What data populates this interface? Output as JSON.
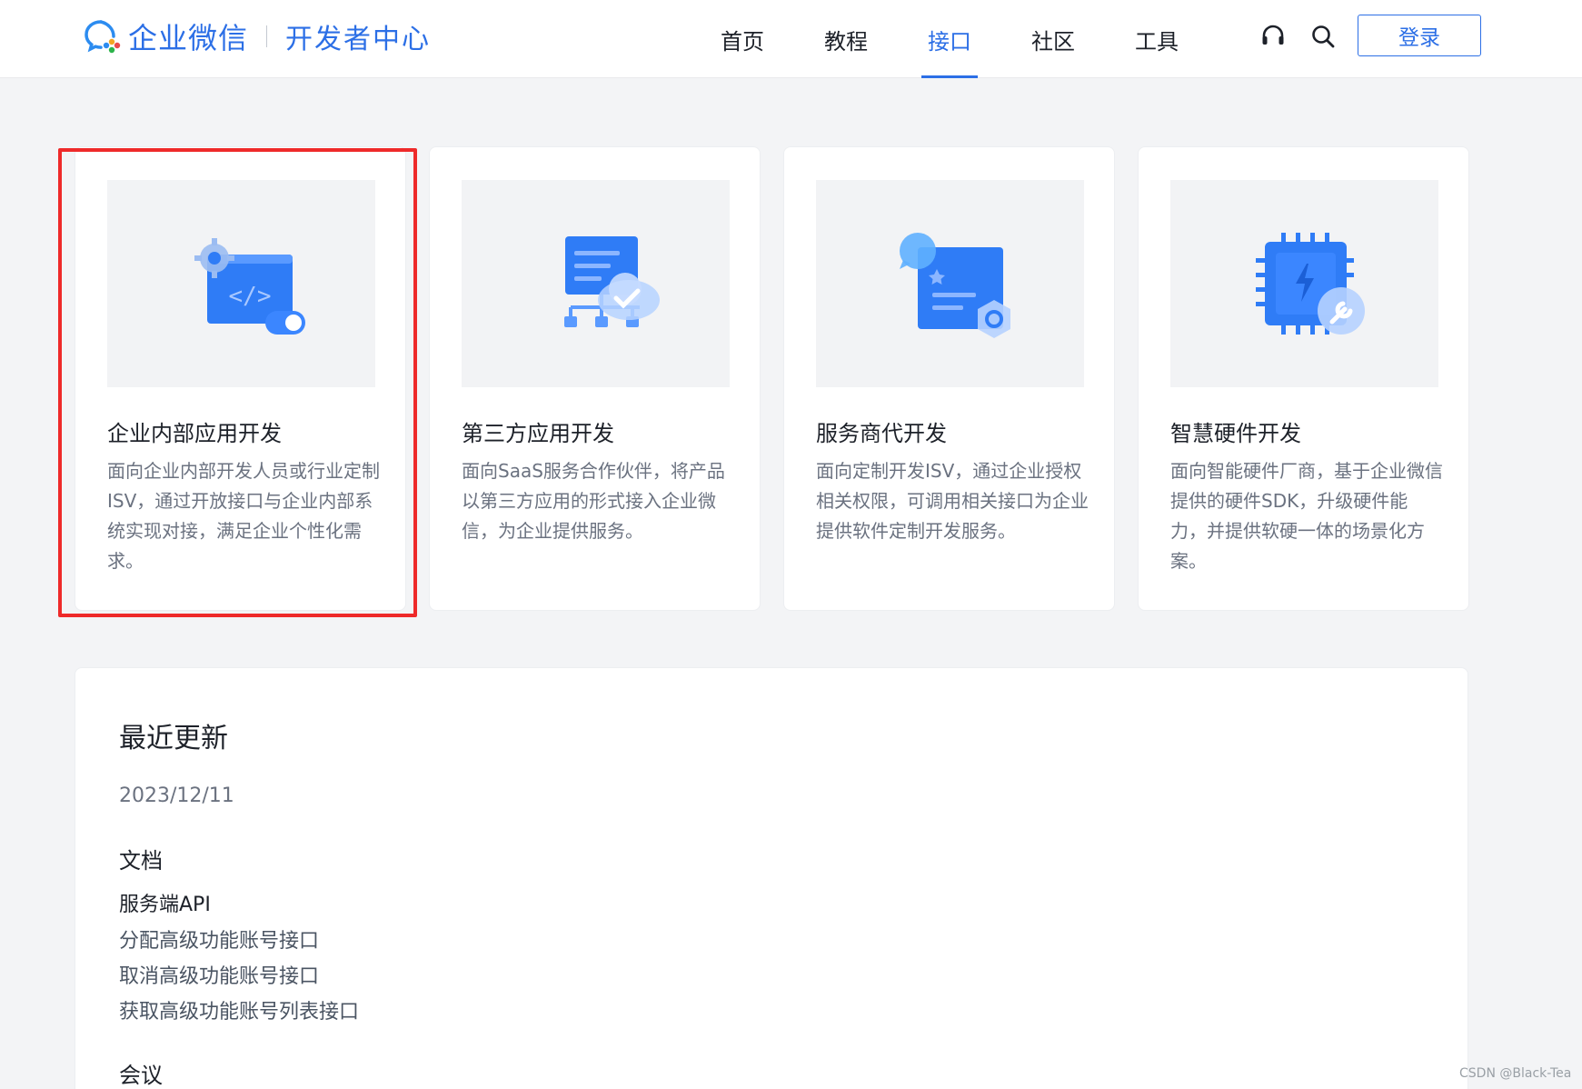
{
  "header": {
    "brand": "企业微信",
    "subtitle": "开发者中心",
    "nav": [
      {
        "label": "首页"
      },
      {
        "label": "教程"
      },
      {
        "label": "接口",
        "active": true
      },
      {
        "label": "社区"
      },
      {
        "label": "工具"
      }
    ],
    "icons": [
      "headset-icon",
      "search-icon"
    ],
    "login_label": "登录"
  },
  "cards": [
    {
      "title": "企业内部应用开发",
      "desc": "面向企业内部开发人员或行业定制ISV，通过开放接口与企业内部系统实现对接，满足企业个性化需求。",
      "icon": "code-window-gear-icon",
      "highlighted": true
    },
    {
      "title": "第三方应用开发",
      "desc": "面向SaaS服务合作伙伴，将产品以第三方应用的形式接入企业微信，为企业提供服务。",
      "icon": "cloud-network-icon"
    },
    {
      "title": "服务商代开发",
      "desc": "面向定制开发ISV，通过企业授权相关权限，可调用相关接口为企业提供软件定制开发服务。",
      "icon": "document-chat-hex-icon"
    },
    {
      "title": "智慧硬件开发",
      "desc": "面向智能硬件厂商，基于企业微信提供的硬件SDK，升级硬件能力，并提供软硬一体的场景化方案。",
      "icon": "chip-wrench-icon"
    }
  ],
  "updates": {
    "title": "最近更新",
    "date": "2023/12/11",
    "categories": [
      {
        "name": "文档",
        "section": "服务端API",
        "links": [
          "分配高级功能账号接口",
          "取消高级功能账号接口",
          "获取高级功能账号列表接口"
        ]
      },
      {
        "name": "会议"
      }
    ]
  },
  "watermark": "CSDN @Black-Tea",
  "colors": {
    "accent": "#2c6fe6",
    "highlight_border": "#ee2a2a",
    "page_bg": "#f3f4f6"
  }
}
